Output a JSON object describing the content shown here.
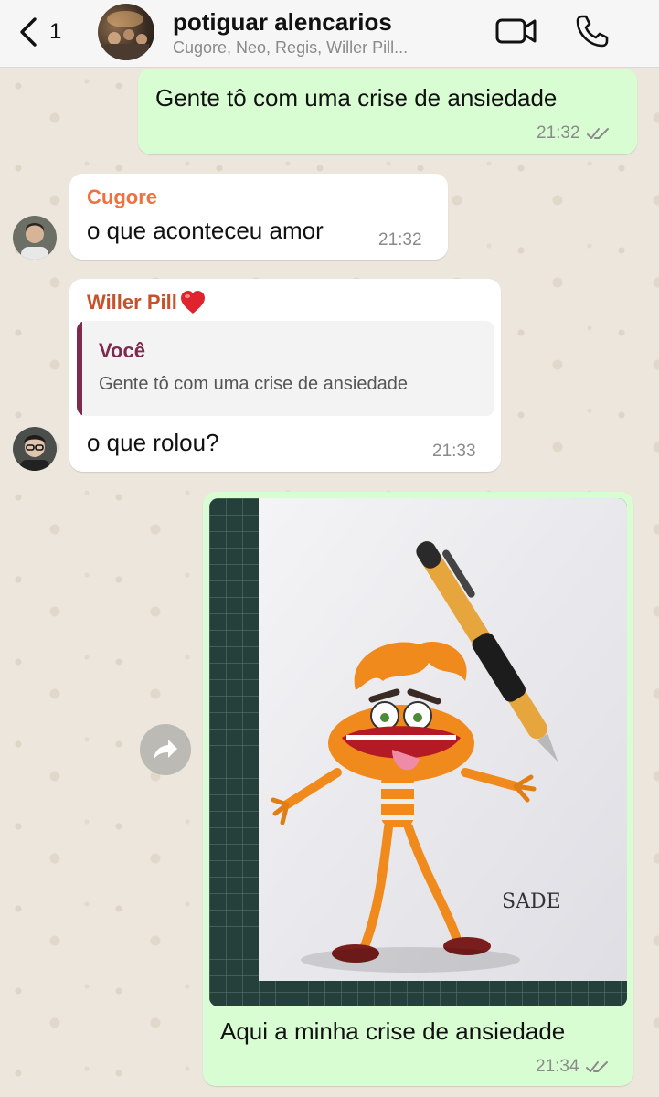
{
  "header": {
    "back_count": "1",
    "title": "potiguar alencarios",
    "members": "Cugore, Neo, Regis, Willer Pill..."
  },
  "messages": [
    {
      "type": "outgoing",
      "text": "Gente tô com uma crise de ansiedade",
      "time": "21:32",
      "status": "read"
    },
    {
      "type": "incoming",
      "sender": "Cugore",
      "sender_color": "#f07040",
      "text": "o que aconteceu amor",
      "time": "21:32"
    },
    {
      "type": "incoming",
      "sender": "Willer Pill",
      "sender_color": "#c5522b",
      "quote": {
        "author": "Você",
        "text": "Gente tô com uma crise de ansiedade"
      },
      "text": "o que rolou?",
      "time": "21:33"
    },
    {
      "type": "outgoing_image",
      "signature": "SADE",
      "caption": "Aqui a minha crise de ansiedade",
      "time": "21:34",
      "status": "read"
    }
  ],
  "colors": {
    "outgoing_bubble": "#d9fdd3",
    "incoming_bubble": "#ffffff",
    "read_ticks": "#8a8a8a",
    "quote_accent": "#7d2a4d"
  },
  "icons": [
    "chevron-left-icon",
    "video-camera-icon",
    "phone-icon",
    "double-check-icon",
    "forward-icon",
    "heart-emoji-icon"
  ]
}
